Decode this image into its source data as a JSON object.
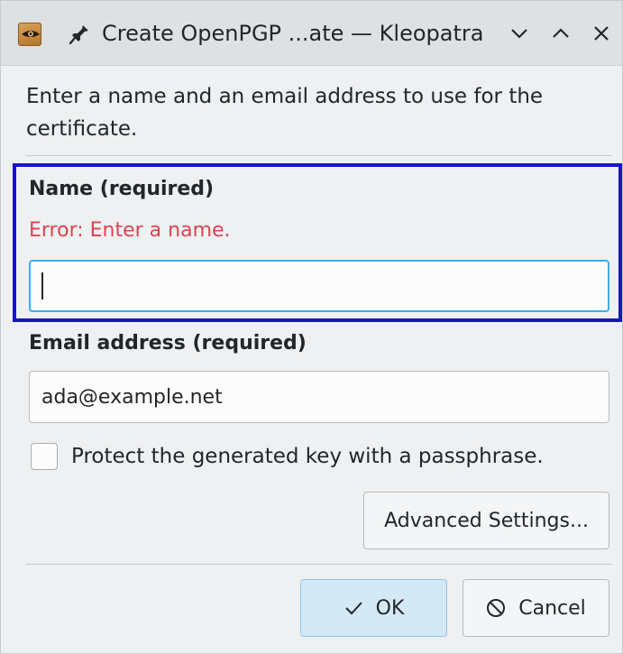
{
  "window": {
    "title": "Create OpenPGP ...ate — Kleopatra",
    "icons": {
      "app": "kleopatra-eye-icon",
      "pin": "pin-icon",
      "minimize": "chevron-down-icon",
      "maximize": "chevron-up-icon",
      "close": "close-icon"
    }
  },
  "dialog": {
    "intro": "Enter a name and an email address to use for the certificate.",
    "name_section": {
      "label": "Name (required)",
      "error": "Error: Enter a name.",
      "value": ""
    },
    "email_section": {
      "label": "Email address (required)",
      "value": "ada@example.net"
    },
    "passphrase_checkbox": {
      "label": "Protect the generated key with a passphrase.",
      "checked": false
    },
    "advanced_button": "Advanced Settings...",
    "ok_button": "OK",
    "cancel_button": "Cancel"
  },
  "colors": {
    "error": "#da4453",
    "focus": "#3daee9",
    "highlight": "#1a14c8",
    "ok_button_bg": "#d3e9f6"
  }
}
